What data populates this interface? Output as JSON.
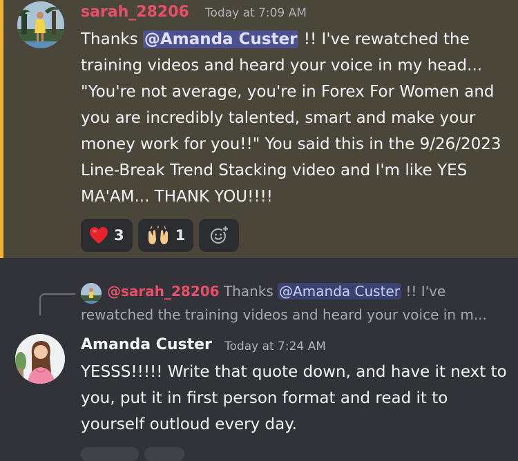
{
  "message1": {
    "author": "sarah_28206",
    "timestamp": "Today at 7:09 AM",
    "text_before_mention": "Thanks ",
    "mention": "@Amanda Custer",
    "text_after_mention": " !! I've rewatched the training videos and heard your voice in my head... \"You're not average, you're in Forex For Women and you are incredibly talented, smart and make your money work for you!!\" You said this in the 9/26/2023 Line-Break Trend Stacking video and I'm like YES MA'AM... THANK YOU!!!!",
    "accent_color": "#f0b232",
    "reactions": [
      {
        "emoji": "❤️",
        "icon": "heart-icon",
        "count": "3"
      },
      {
        "emoji": "🙌🏼",
        "icon": "raised-hands-icon",
        "count": "1"
      }
    ],
    "add_reaction_icon": "add-reaction-icon"
  },
  "reply_preview": {
    "author": "@sarah_28206",
    "text_before_mention": " Thanks ",
    "mention": "@Amanda Custer",
    "text_after_mention": " !! I've",
    "line2": "rewatched the training videos and heard your voice in m..."
  },
  "message2": {
    "author": "Amanda Custer",
    "timestamp": "Today at 7:24 AM",
    "text": "YESSS!!!!! Write that quote down, and have it next to you, put it in first person format and read it to yourself outloud every day."
  }
}
